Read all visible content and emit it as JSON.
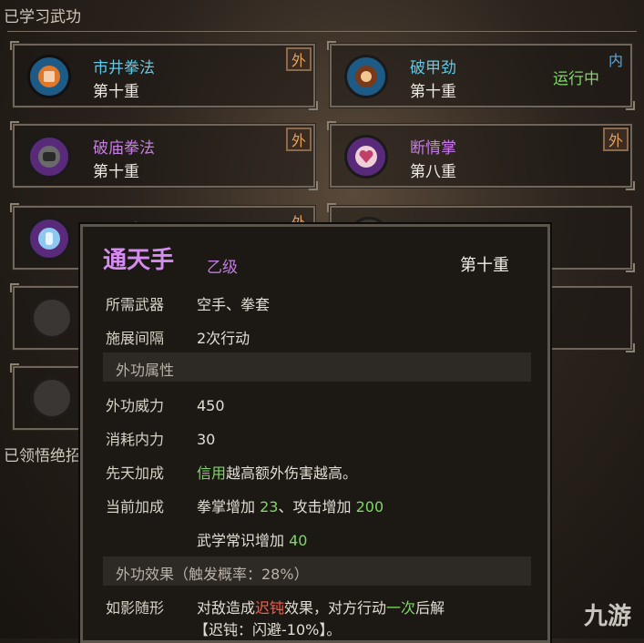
{
  "section_learned": "已学习武功",
  "section_comprehended": "已领悟绝招",
  "skills": [
    {
      "name": "市井拳法",
      "level": "第十重",
      "badge": "外",
      "name_color": "#5ec9e8",
      "icon": "fist-icon"
    },
    {
      "name": "破甲劲",
      "level": "第十重",
      "badge": "内",
      "status": "运行中",
      "name_color": "#5ec9e8",
      "icon": "burst-icon"
    },
    {
      "name": "破庙拳法",
      "level": "第十重",
      "badge": "外",
      "name_color": "#c77de6",
      "icon": "gauntlet-icon"
    },
    {
      "name": "断情掌",
      "level": "第八重",
      "badge": "外",
      "name_color": "#c77de6",
      "icon": "broken-heart-icon"
    },
    {
      "name": "通天手",
      "badge": "外",
      "name_color": "#c77de6",
      "icon": "open-palm-icon"
    }
  ],
  "tooltip": {
    "title": "通天手",
    "grade": "乙级",
    "level": "第十重",
    "weapon_label": "所需武器",
    "weapon_value": "空手、拳套",
    "interval_label": "施展间隔",
    "interval_value": "2次行动",
    "section_attr": "外功属性",
    "power_label": "外功威力",
    "power_value": "450",
    "cost_label": "消耗内力",
    "cost_value": "30",
    "innate_label": "先天加成",
    "innate_highlight": "信用",
    "innate_text": "越高额外伤害越高。",
    "current_label": "当前加成",
    "bonus1_text": "拳掌增加",
    "bonus1_value": "23",
    "bonus_sep": "、",
    "bonus2_text": "攻击增加",
    "bonus2_value": "200",
    "bonus3_text": "武学常识增加",
    "bonus3_value": "40",
    "section_effect": "外功效果（触发概率：28%）",
    "effect_label": "如影随形",
    "effect_text1": "对敌造成",
    "effect_highlight1": "迟钝",
    "effect_text2": "效果，对方行动",
    "effect_highlight2": "一次",
    "effect_text3": "后解",
    "effect_note": "【迟钝：闪避-10%】。"
  },
  "watermark": "九游"
}
